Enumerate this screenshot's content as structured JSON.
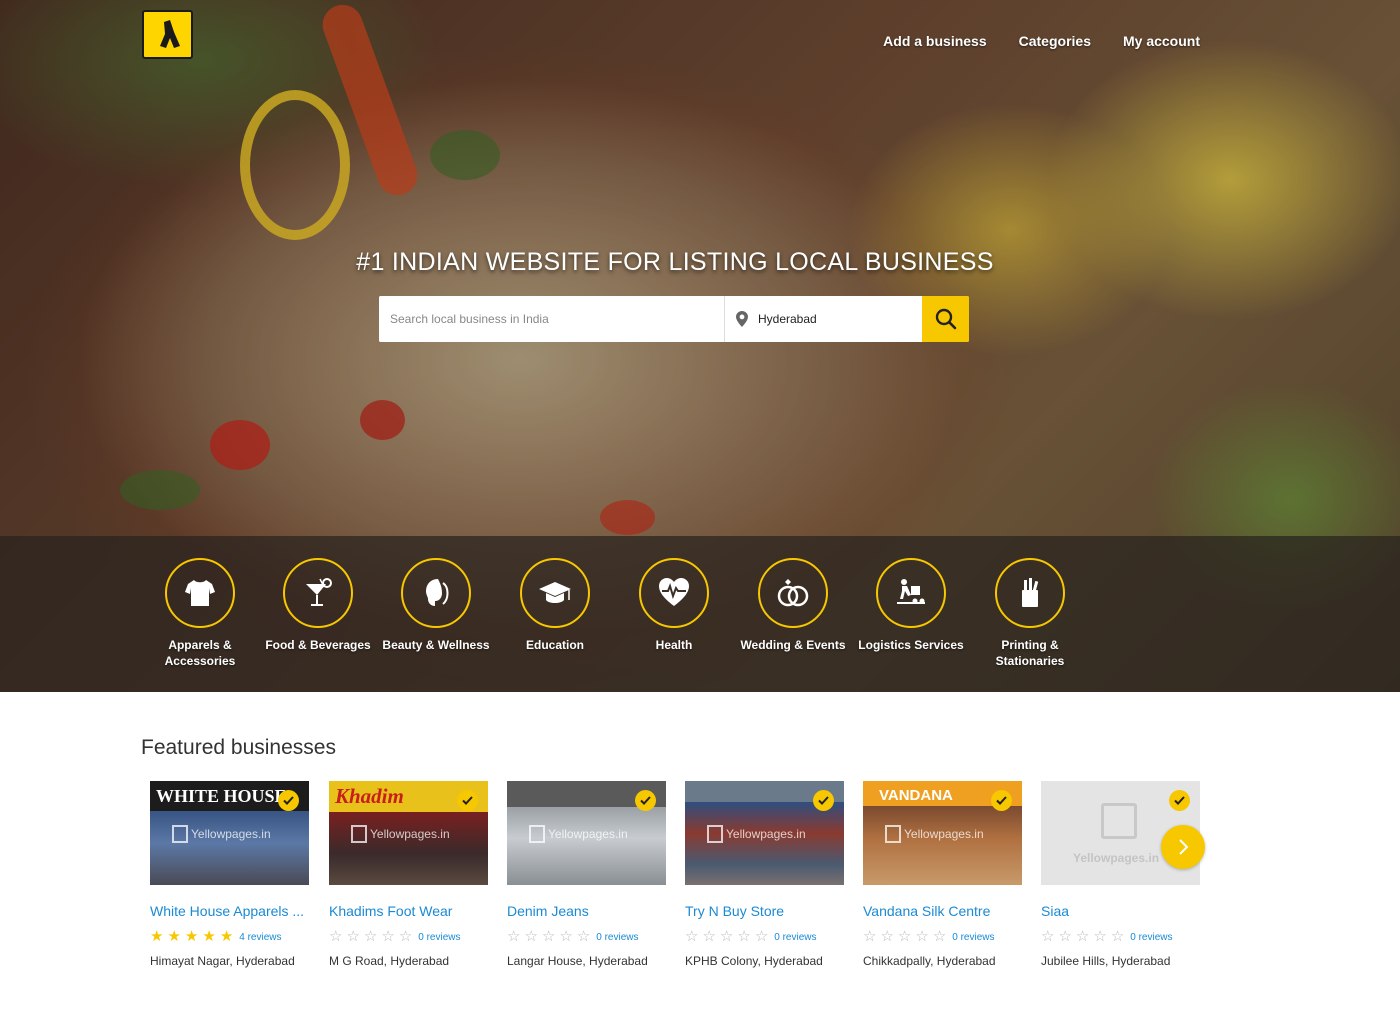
{
  "header": {
    "logo_alt": "Yellow Pages",
    "nav": [
      "Add a business",
      "Categories",
      "My account"
    ]
  },
  "hero": {
    "headline": "#1 INDIAN WEBSITE FOR LISTING LOCAL BUSINESS",
    "search": {
      "placeholder": "Search local business in India",
      "location_value": "Hyderabad",
      "button_icon": "search-icon"
    },
    "categories": [
      {
        "label": "Apparels & Accessories",
        "icon": "shirt-icon"
      },
      {
        "label": "Food & Beverages",
        "icon": "cocktail-icon"
      },
      {
        "label": "Beauty & Wellness",
        "icon": "face-icon"
      },
      {
        "label": "Education",
        "icon": "graduation-cap-icon"
      },
      {
        "label": "Health",
        "icon": "heart-pulse-icon"
      },
      {
        "label": "Wedding & Events",
        "icon": "rings-icon"
      },
      {
        "label": "Logistics Services",
        "icon": "handcart-icon"
      },
      {
        "label": "Printing & Stationaries",
        "icon": "pen-holder-icon"
      }
    ]
  },
  "featured": {
    "title": "Featured businesses",
    "watermark": "Yellowpages.in",
    "businesses": [
      {
        "name": "White House Apparels ...",
        "sign": "WHITE HOUSE",
        "rating": 5,
        "reviews": "4 reviews",
        "location": "Himayat Nagar, Hyderabad"
      },
      {
        "name": "Khadims Foot Wear",
        "sign": "Khadim",
        "rating": 0,
        "reviews": "0 reviews",
        "location": "M G Road, Hyderabad"
      },
      {
        "name": "Denim Jeans",
        "sign": "",
        "rating": 0,
        "reviews": "0 reviews",
        "location": "Langar House, Hyderabad"
      },
      {
        "name": "Try N Buy Store",
        "sign": "",
        "rating": 0,
        "reviews": "0 reviews",
        "location": "KPHB Colony, Hyderabad"
      },
      {
        "name": "Vandana Silk Centre",
        "sign": "VANDANA",
        "rating": 0,
        "reviews": "0 reviews",
        "location": "Chikkadpally, Hyderabad"
      },
      {
        "name": "Siaa",
        "sign": "",
        "rating": 0,
        "reviews": "0 reviews",
        "location": "Jubilee Hills, Hyderabad"
      }
    ],
    "next_icon": "chevron-right-icon"
  },
  "colors": {
    "accent": "#f7c700",
    "link": "#1a8ad4"
  }
}
